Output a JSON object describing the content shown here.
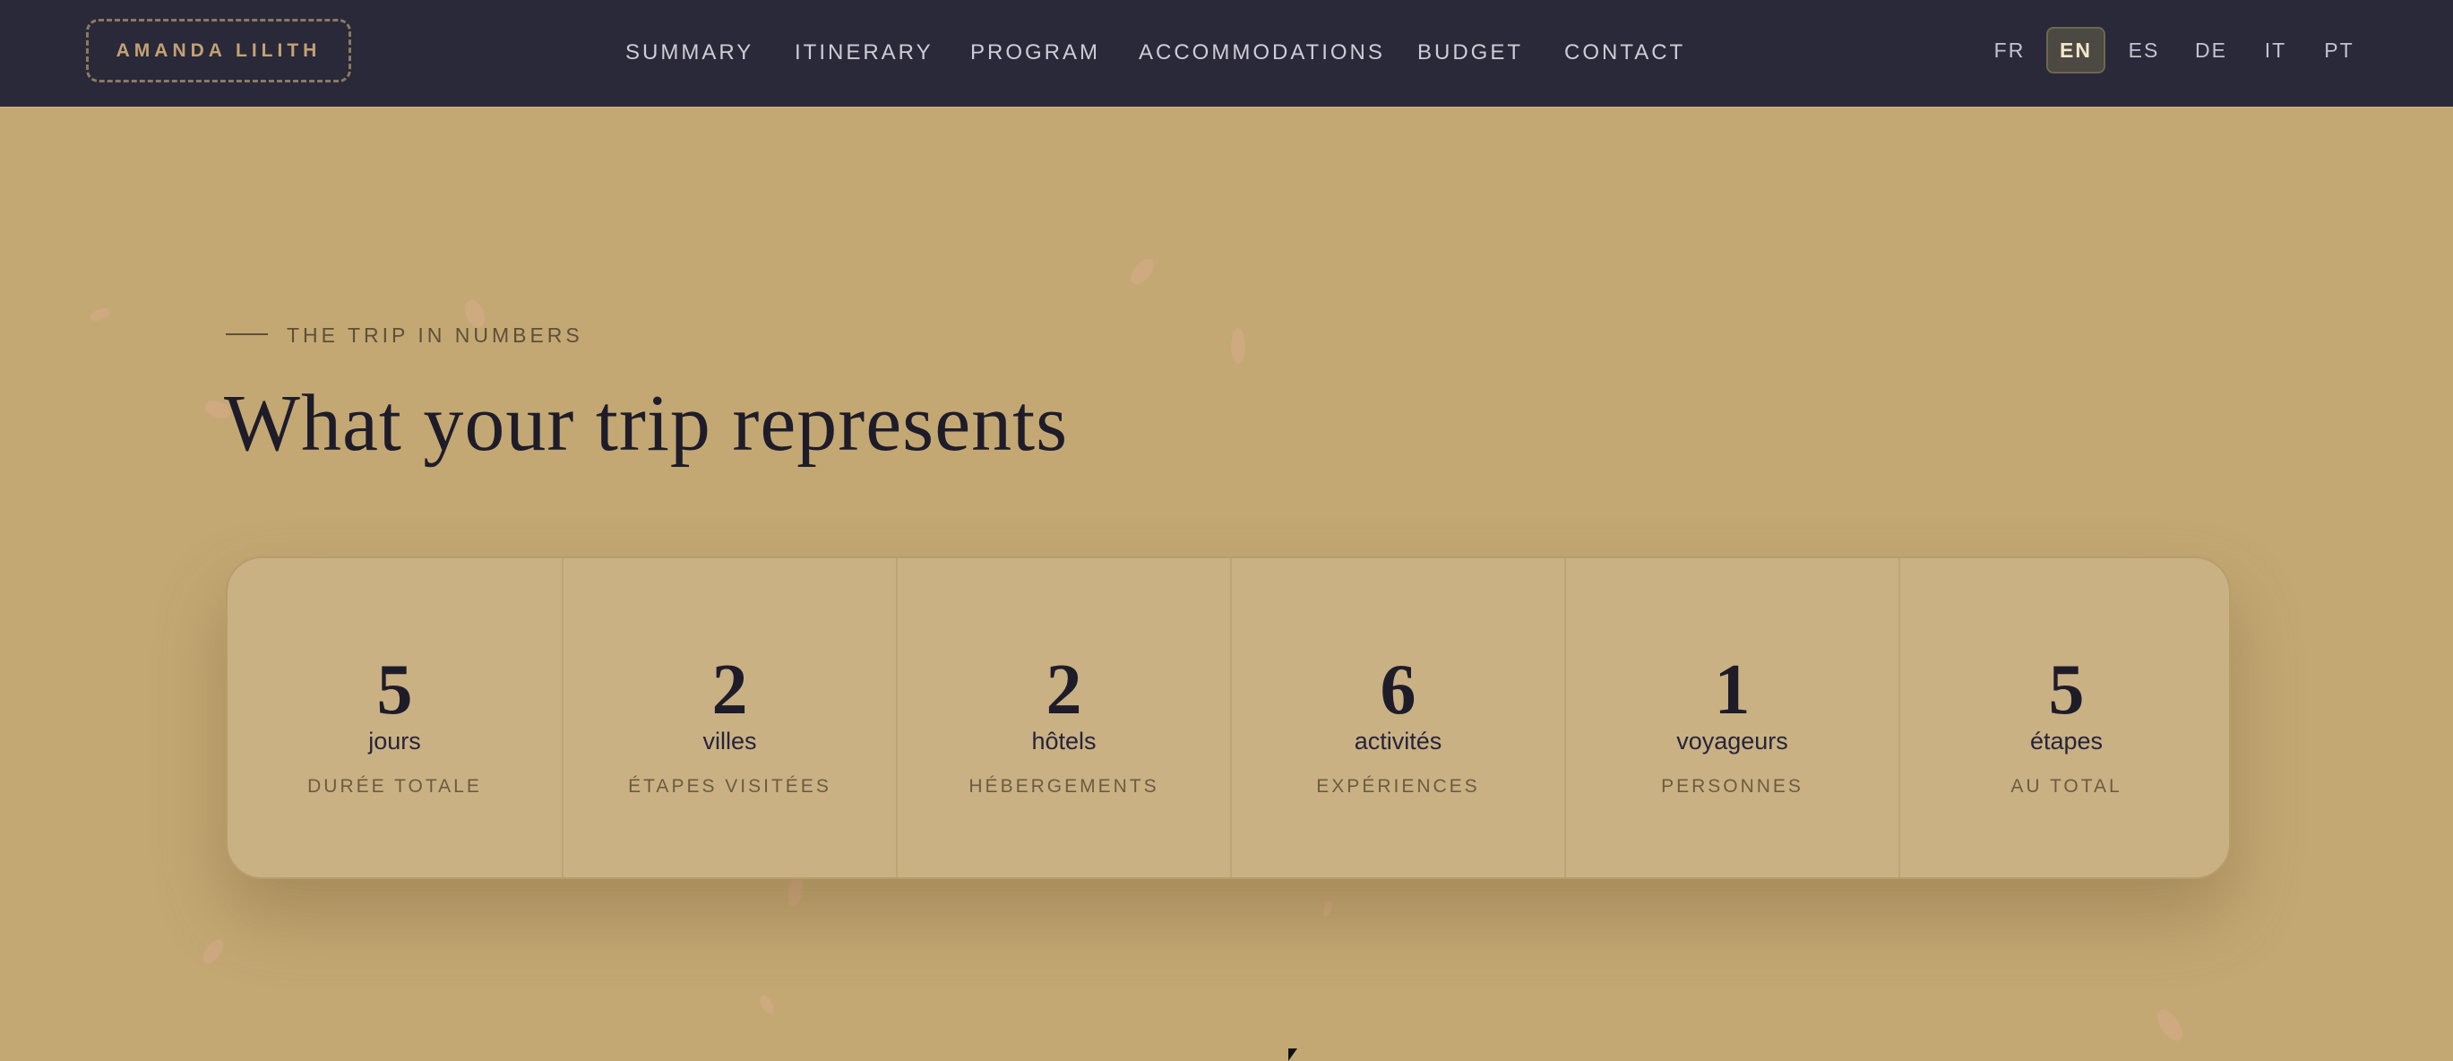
{
  "nav": {
    "logo": "AMANDA LILITH",
    "items": [
      {
        "label": "SUMMARY"
      },
      {
        "label": "ITINERARY"
      },
      {
        "label": "PROGRAM"
      },
      {
        "label": "ACCOMMODATIONS"
      },
      {
        "label": "BUDGET"
      },
      {
        "label": "CONTACT"
      }
    ],
    "languages": [
      {
        "label": "FR",
        "active": false
      },
      {
        "label": "EN",
        "active": true
      },
      {
        "label": "ES",
        "active": false
      },
      {
        "label": "DE",
        "active": false
      },
      {
        "label": "IT",
        "active": false
      },
      {
        "label": "PT",
        "active": false
      }
    ]
  },
  "hero": {
    "eyebrow": "THE TRIP IN NUMBERS",
    "title": "What your trip represents"
  },
  "stats": [
    {
      "value": "5",
      "label": "jours",
      "sublabel": "DURÉE TOTALE"
    },
    {
      "value": "2",
      "label": "villes",
      "sublabel": "ÉTAPES VISITÉES"
    },
    {
      "value": "2",
      "label": "hôtels",
      "sublabel": "HÉBERGEMENTS"
    },
    {
      "value": "6",
      "label": "activités",
      "sublabel": "EXPÉRIENCES"
    },
    {
      "value": "1",
      "label": "voyageurs",
      "sublabel": "PERSONNES"
    },
    {
      "value": "5",
      "label": "étapes",
      "sublabel": "AU TOTAL"
    }
  ],
  "colors": {
    "nav_bg": "#2a293a",
    "page_bg": "#c3a874",
    "card_bg": "#c9b184",
    "accent_gold": "#c3a272",
    "text_dark": "#1f1c2a"
  }
}
